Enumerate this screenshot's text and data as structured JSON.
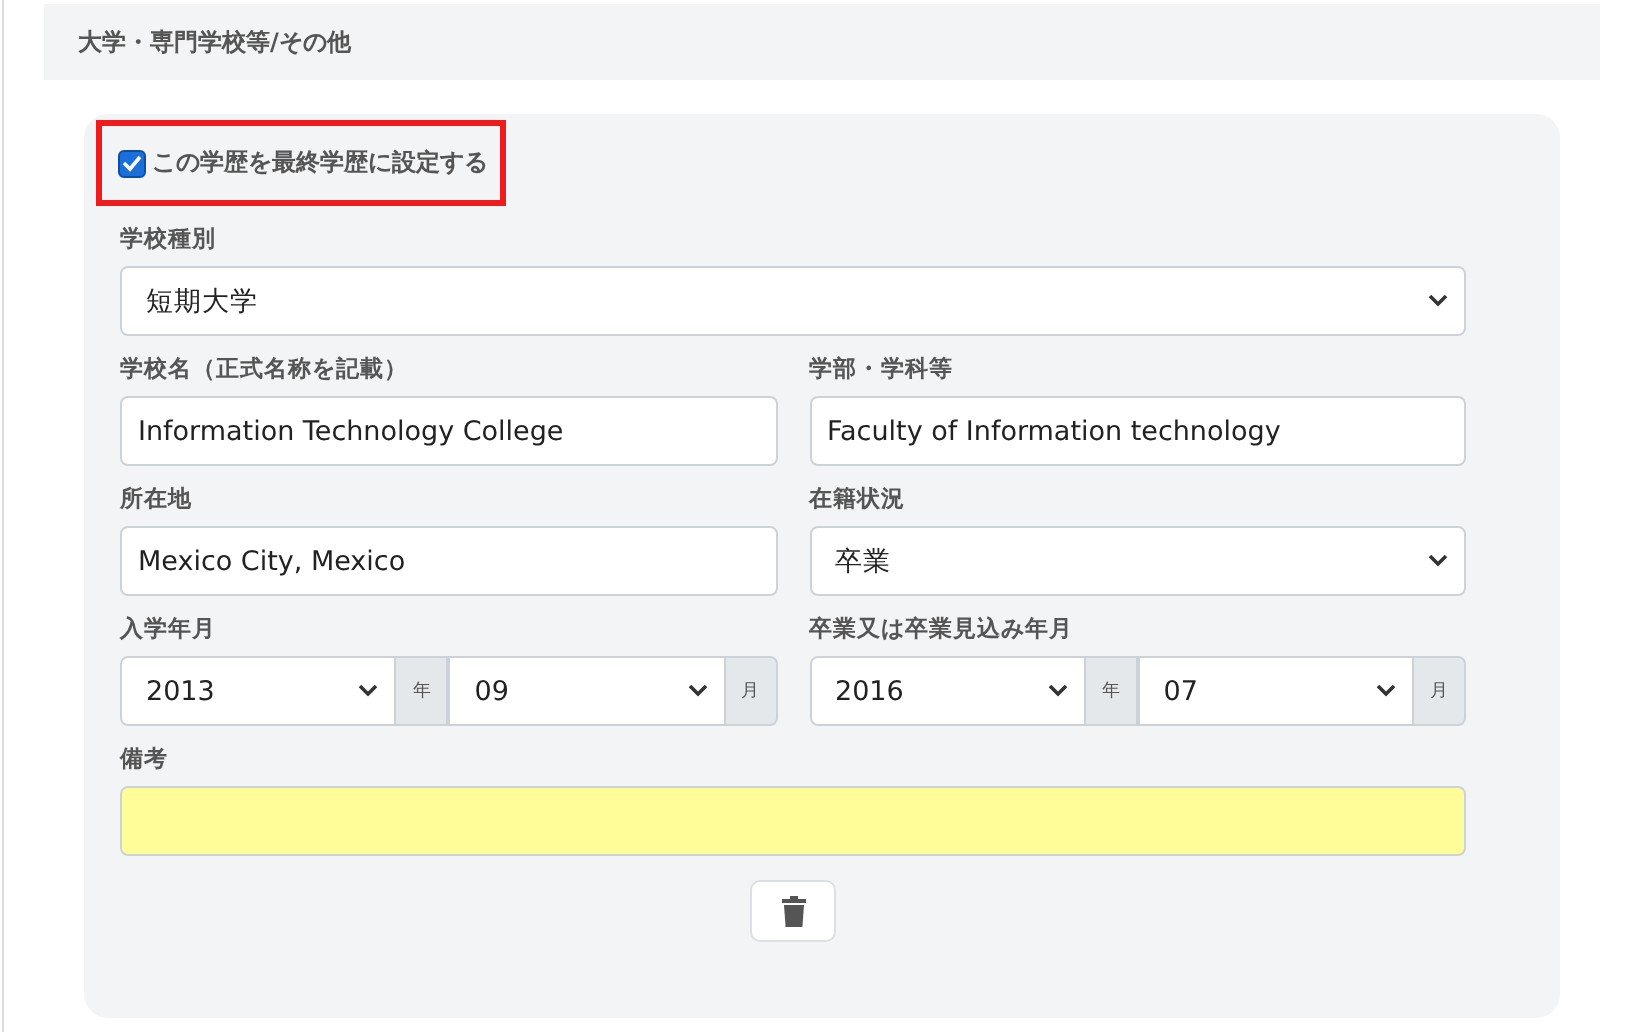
{
  "section": {
    "title": "大学・専門学校等/その他"
  },
  "final_education": {
    "label": "この学歴を最終学歴に設定する",
    "checked": true,
    "highlighted": true
  },
  "school_type": {
    "label": "学校種別",
    "value": "短期大学"
  },
  "rows": [
    {
      "left": {
        "label": "学校名（正式名称を記載）",
        "kind": "text",
        "value": "Information Technology College"
      },
      "right": {
        "label": "学部・学科等",
        "kind": "text",
        "value": "Faculty of Information technology"
      }
    },
    {
      "left": {
        "label": "所在地",
        "kind": "text",
        "value": "Mexico City, Mexico"
      },
      "right": {
        "label": "在籍状況",
        "kind": "select",
        "value": "卒業"
      }
    }
  ],
  "dates": [
    {
      "label": "入学年月",
      "year": "2013",
      "year_unit": "年",
      "month": "09",
      "month_unit": "月"
    },
    {
      "label": "卒業又は卒業見込み年月",
      "year": "2016",
      "year_unit": "年",
      "month": "07",
      "month_unit": "月"
    }
  ],
  "remarks": {
    "label": "備考",
    "highlighted": true
  }
}
